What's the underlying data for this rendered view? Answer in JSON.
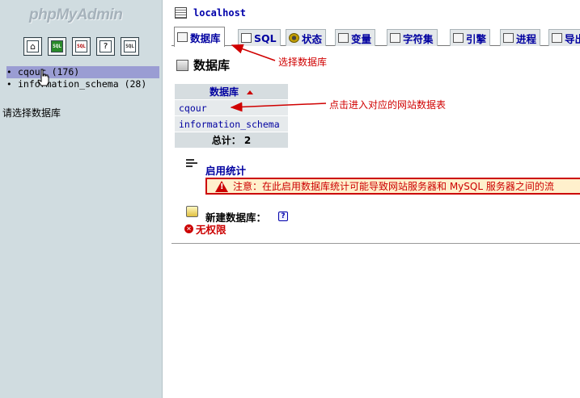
{
  "nav": {
    "logo": "phpMyAdmin",
    "icons": [
      "home-icon",
      "query-window-icon",
      "sql-icon",
      "docs-icon",
      "sql-docs-icon"
    ],
    "icon_glyphs": [
      "⌂",
      "SQL",
      "SQL",
      "?",
      "SQL"
    ],
    "databases": [
      {
        "name": "cqour",
        "count": "(176)"
      },
      {
        "name": "information_schema",
        "count": "(28)"
      }
    ],
    "hint": "请选择数据库"
  },
  "server": {
    "label": "localhost"
  },
  "tabs": [
    {
      "label": "数据库",
      "icon": "databases-icon",
      "active": true
    },
    {
      "label": "SQL",
      "icon": "sql-icon",
      "active": false
    },
    {
      "label": "状态",
      "icon": "status-icon",
      "active": false
    },
    {
      "label": "变量",
      "icon": "variables-icon",
      "active": false
    },
    {
      "label": "字符集",
      "icon": "charset-icon",
      "active": false
    },
    {
      "label": "引擎",
      "icon": "engines-icon",
      "active": false
    },
    {
      "label": "进程",
      "icon": "processes-icon",
      "active": false
    },
    {
      "label": "导出",
      "icon": "export-icon",
      "active": false
    }
  ],
  "page": {
    "title": "数据库",
    "table_header": "数据库",
    "databases": [
      "cqour",
      "information_schema"
    ],
    "total_label": "总计： 2",
    "stats_link": "启用统计",
    "notice": "注意：在此启用数据库统计可能导致网站服务器和 MySQL 服务器之间的流",
    "newdb_label": "新建数据库：",
    "help_glyph": "?",
    "no_privileges": "无权限"
  },
  "annotations": {
    "select_db": "选择数据库",
    "click_db": "点击进入对应的网站数据表"
  },
  "colors": {
    "nav_bg": "#d0dce0",
    "link": "#0000a0",
    "annotation": "#d00000",
    "selected_row": "#9a9dd3"
  }
}
